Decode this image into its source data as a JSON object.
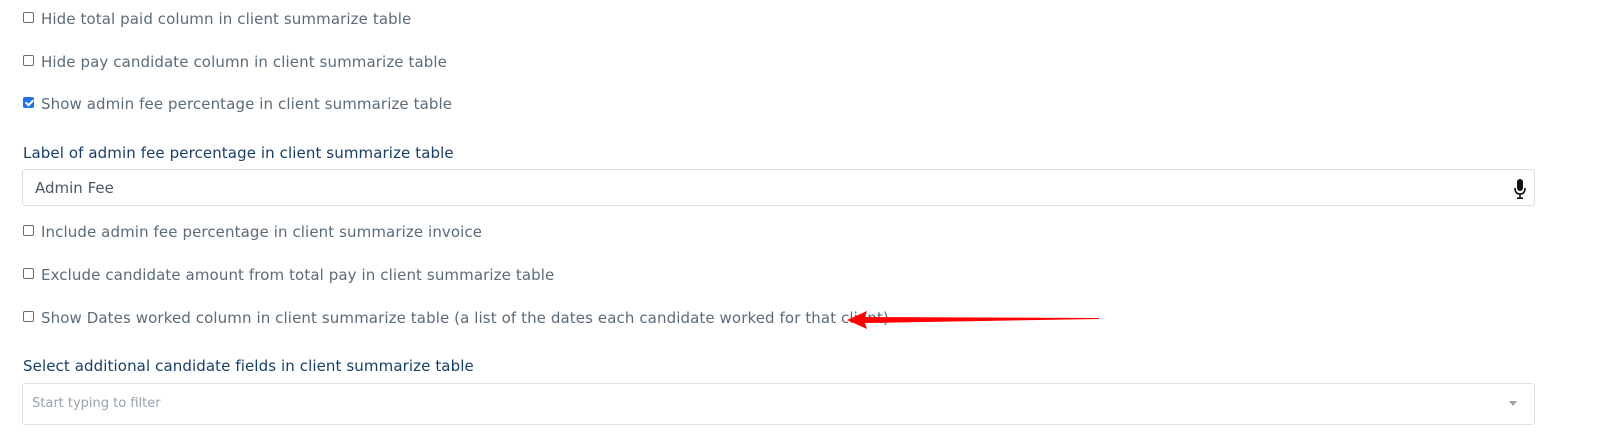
{
  "settings": {
    "hide_total_paid": {
      "label": "Hide total paid column in client summarize table",
      "checked": false
    },
    "hide_pay_candidate": {
      "label": "Hide pay candidate column in client summarize table",
      "checked": false
    },
    "show_admin_fee_pct": {
      "label": "Show admin fee percentage in client summarize table",
      "checked": true
    },
    "admin_fee_label_field": {
      "label": "Label of admin fee percentage in client summarize table",
      "value": "Admin Fee"
    },
    "include_admin_fee_invoice": {
      "label": "Include admin fee percentage in client summarize invoice",
      "checked": false
    },
    "exclude_candidate_amount": {
      "label": "Exclude candidate amount from total pay in client summarize table",
      "checked": false
    },
    "show_dates_worked": {
      "label": "Show Dates worked column in client summarize table (a list of the dates each candidate worked for that client)",
      "checked": false
    },
    "additional_fields": {
      "label": "Select additional candidate fields in client summarize table",
      "placeholder": "Start typing to filter"
    }
  },
  "icons": {
    "microphone": "microphone-icon",
    "dropdown": "chevron-down-icon",
    "annotation": "red-arrow-annotation"
  },
  "colors": {
    "label_text": "#5b6b79",
    "field_label_text": "#173e6b",
    "checkbox_checked": "#1a73e8",
    "annotation_arrow": "#ff0000"
  }
}
